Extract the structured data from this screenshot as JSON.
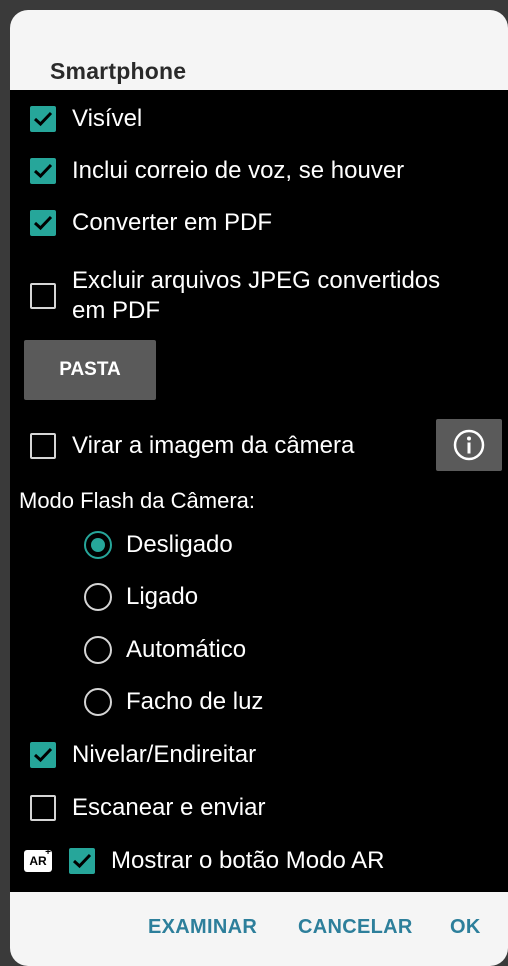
{
  "dialog": {
    "title": "Smartphone"
  },
  "options": {
    "visible": {
      "label": "Visível",
      "checked": true
    },
    "voicemail": {
      "label": "Inclui correio de voz, se houver",
      "checked": true
    },
    "convert_pdf": {
      "label": "Converter em PDF",
      "checked": true
    },
    "delete_jpeg": {
      "label_line1": "Excluir arquivos JPEG convertidos",
      "label_line2": "em PDF",
      "checked": false
    },
    "folder_button": "PASTA",
    "flip_camera": {
      "label": "Virar a imagem da câmera",
      "checked": false
    },
    "info_icon": "info-icon"
  },
  "flash": {
    "label": "Modo Flash da Câmera:",
    "options": [
      "Desligado",
      "Ligado",
      "Automático",
      "Facho de luz"
    ],
    "selected": "Desligado"
  },
  "more_options": {
    "level": {
      "label": "Nivelar/Endireitar",
      "checked": true
    },
    "scan_send": {
      "label": "Escanear e enviar",
      "checked": false
    },
    "ar_mode": {
      "label": "Mostrar o botão Modo AR",
      "checked": true,
      "icon_text": "AR",
      "icon_sup": "+"
    }
  },
  "footer": {
    "browse": "EXAMINAR",
    "cancel": "CANCELAR",
    "ok": "OK"
  },
  "colors": {
    "accent": "#26a69a",
    "footer_text": "#2d7f9b",
    "content_bg": "#000000",
    "button_bg": "#5a5a5a"
  }
}
